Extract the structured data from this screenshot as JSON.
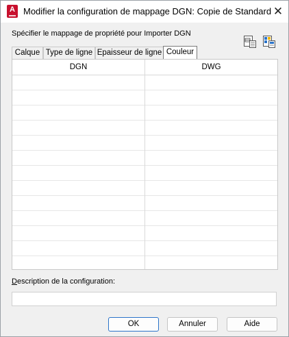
{
  "window": {
    "title": "Modifier la configuration de mappage DGN: Copie de Standard",
    "app_icon_letter": "A",
    "close_glyph": "✕"
  },
  "mapping": {
    "section_label": "Spécifier le mappage de propriété pour Importer DGN",
    "tabs": [
      {
        "label": "Calque",
        "active": false
      },
      {
        "label": "Type de ligne",
        "active": false
      },
      {
        "label": "Epaisseur de ligne",
        "active": false
      },
      {
        "label": "Couleur",
        "active": true
      }
    ],
    "columns": [
      "DGN",
      "DWG"
    ],
    "rows": []
  },
  "description": {
    "label_mnemonic": "D",
    "label_rest": "escription de la configuration:",
    "value": ""
  },
  "buttons": {
    "ok": "OK",
    "cancel": "Annuler",
    "help": "Aide"
  },
  "icons": {
    "app": "autocad-app-icon",
    "tool1": "load-mapping-icon",
    "tool2": "save-mapping-icon"
  },
  "colors": {
    "accent": "#2a73c9",
    "app_icon": "#c8102e"
  }
}
